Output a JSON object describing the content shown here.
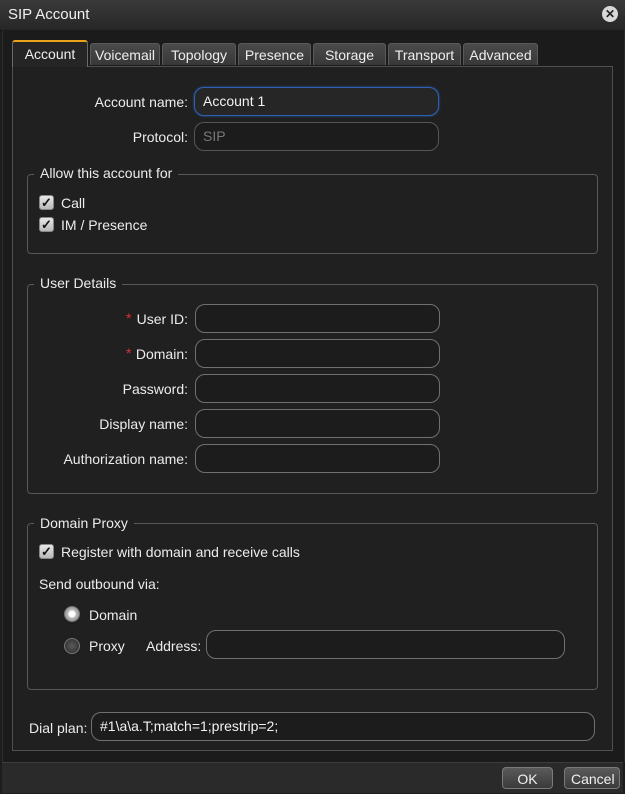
{
  "window": {
    "title": "SIP Account"
  },
  "tabs": [
    "Account",
    "Voicemail",
    "Topology",
    "Presence",
    "Storage",
    "Transport",
    "Advanced"
  ],
  "account": {
    "name_label": "Account name:",
    "name_value": "Account 1",
    "protocol_label": "Protocol:",
    "protocol_placeholder": "SIP"
  },
  "allow": {
    "title": "Allow this account for",
    "call_label": "Call",
    "im_label": "IM / Presence"
  },
  "user": {
    "title": "User Details",
    "required_mark": "*",
    "user_id_label": "User ID:",
    "domain_label": "Domain:",
    "password_label": "Password:",
    "display_name_label": "Display name:",
    "auth_name_label": "Authorization name:"
  },
  "proxy": {
    "title": "Domain Proxy",
    "register_label": "Register with domain and receive calls",
    "send_outbound_label": "Send outbound via:",
    "domain_option": "Domain",
    "proxy_option": "Proxy",
    "address_label": "Address:"
  },
  "dialplan": {
    "label": "Dial plan:",
    "value": "#1\\a\\a.T;match=1;prestrip=2;"
  },
  "footer": {
    "ok_label": "OK",
    "cancel_label": "Cancel"
  },
  "colors": {
    "accent": "#e9a21a",
    "focus": "#2e5fb0",
    "required": "#e03030"
  }
}
